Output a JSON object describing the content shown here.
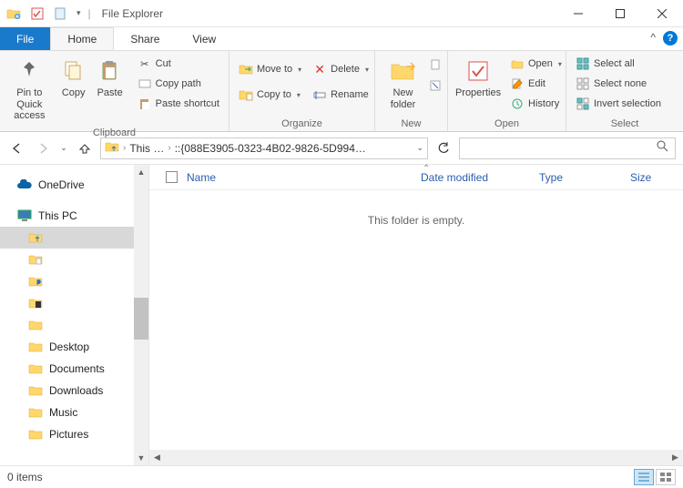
{
  "window": {
    "title": "File Explorer"
  },
  "tabs": {
    "file": "File",
    "home": "Home",
    "share": "Share",
    "view": "View"
  },
  "ribbon": {
    "clipboard": {
      "label": "Clipboard",
      "pin": "Pin to Quick access",
      "copy": "Copy",
      "paste": "Paste",
      "cut": "Cut",
      "copypath": "Copy path",
      "pasteshortcut": "Paste shortcut"
    },
    "organize": {
      "label": "Organize",
      "moveto": "Move to",
      "copyto": "Copy to",
      "delete": "Delete",
      "rename": "Rename"
    },
    "new": {
      "label": "New",
      "newfolder": "New folder"
    },
    "open": {
      "label": "Open",
      "properties": "Properties",
      "open": "Open",
      "edit": "Edit",
      "history": "History"
    },
    "select": {
      "label": "Select",
      "selectall": "Select all",
      "selectnone": "Select none",
      "invert": "Invert selection"
    }
  },
  "breadcrumbs": {
    "c1": "This …",
    "c2": "::{088E3905-0323-4B02-9826-5D994…"
  },
  "columns": {
    "name": "Name",
    "date": "Date modified",
    "type": "Type",
    "size": "Size"
  },
  "emptymsg": "This folder is empty.",
  "tree": {
    "onedrive": "OneDrive",
    "thispc": "This PC",
    "desktop": "Desktop",
    "documents": "Documents",
    "downloads": "Downloads",
    "music": "Music",
    "pictures": "Pictures"
  },
  "status": {
    "items": "0 items"
  }
}
